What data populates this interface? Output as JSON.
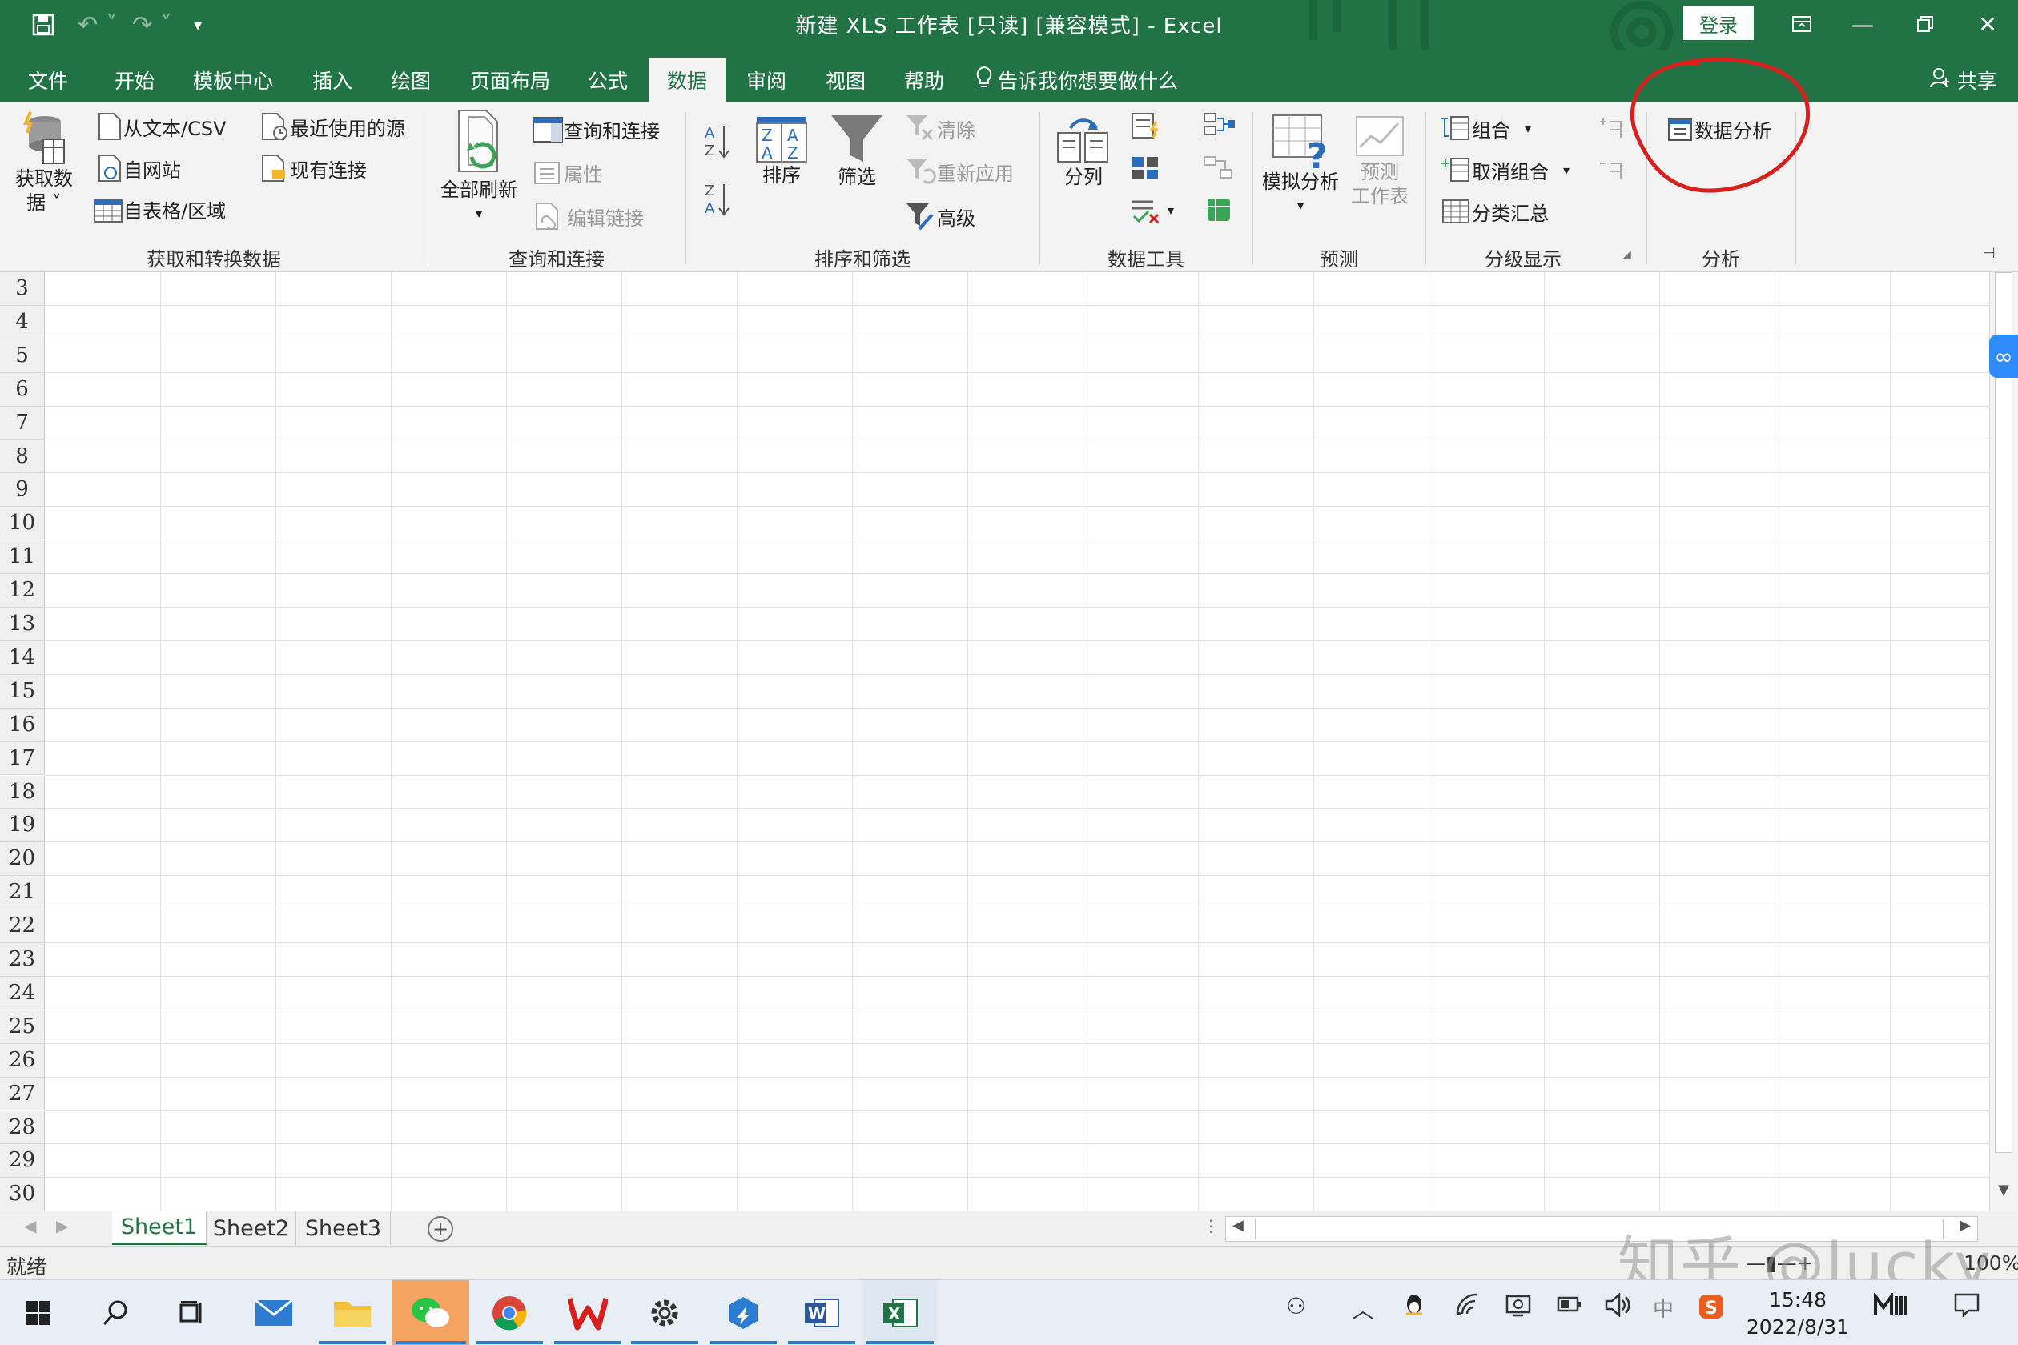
{
  "window": {
    "title": "新建 XLS 工作表 [只读] [兼容模式] - Excel",
    "login_label": "登录"
  },
  "tabs": [
    {
      "label": "文件"
    },
    {
      "label": "开始"
    },
    {
      "label": "模板中心"
    },
    {
      "label": "插入"
    },
    {
      "label": "绘图"
    },
    {
      "label": "页面布局"
    },
    {
      "label": "公式"
    },
    {
      "label": "数据"
    },
    {
      "label": "审阅"
    },
    {
      "label": "视图"
    },
    {
      "label": "帮助"
    }
  ],
  "tell_me": "告诉我你想要做什么",
  "share": "共享",
  "ribbon": {
    "get_data": {
      "line1": "获取数",
      "line2": "据 ˅"
    },
    "from_text": "从文本/CSV",
    "from_web": "自网站",
    "from_table": "自表格/区域",
    "recent_sources": "最近使用的源",
    "existing_conn": "现有连接",
    "group_get": "获取和转换数据",
    "refresh_all": "全部刷新",
    "queries_conn": "查询和连接",
    "properties": "属性",
    "edit_links": "编辑链接",
    "group_queries": "查询和连接",
    "sort": "排序",
    "filter": "筛选",
    "clear": "清除",
    "reapply": "重新应用",
    "advanced": "高级",
    "group_sort": "排序和筛选",
    "text_to_columns": "分列",
    "group_tools": "数据工具",
    "what_if": "模拟分析",
    "forecast_sheet": {
      "line1": "预测",
      "line2": "工作表"
    },
    "group_forecast": "预测",
    "group": "组合",
    "ungroup": "取消组合",
    "subtotal": "分类汇总",
    "group_outline": "分级显示",
    "data_analysis": "数据分析",
    "group_analysis": "分析"
  },
  "rows": [
    "3",
    "4",
    "5",
    "6",
    "7",
    "8",
    "9",
    "10",
    "11",
    "12",
    "13",
    "14",
    "15",
    "16",
    "17",
    "18",
    "19",
    "20",
    "21",
    "22",
    "23",
    "24",
    "25",
    "26",
    "27",
    "28",
    "29",
    "30"
  ],
  "sheets": [
    {
      "label": "Sheet1",
      "active": true
    },
    {
      "label": "Sheet2",
      "active": false
    },
    {
      "label": "Sheet3",
      "active": false
    }
  ],
  "status": {
    "ready": "就绪",
    "zoom": "100%",
    "watermark": "知乎 @lucky"
  },
  "taskbar": {
    "time": "15:48",
    "date": "2022/8/31"
  },
  "colors": {
    "excel_green": "#217346",
    "annotation_red": "#d9201c"
  }
}
